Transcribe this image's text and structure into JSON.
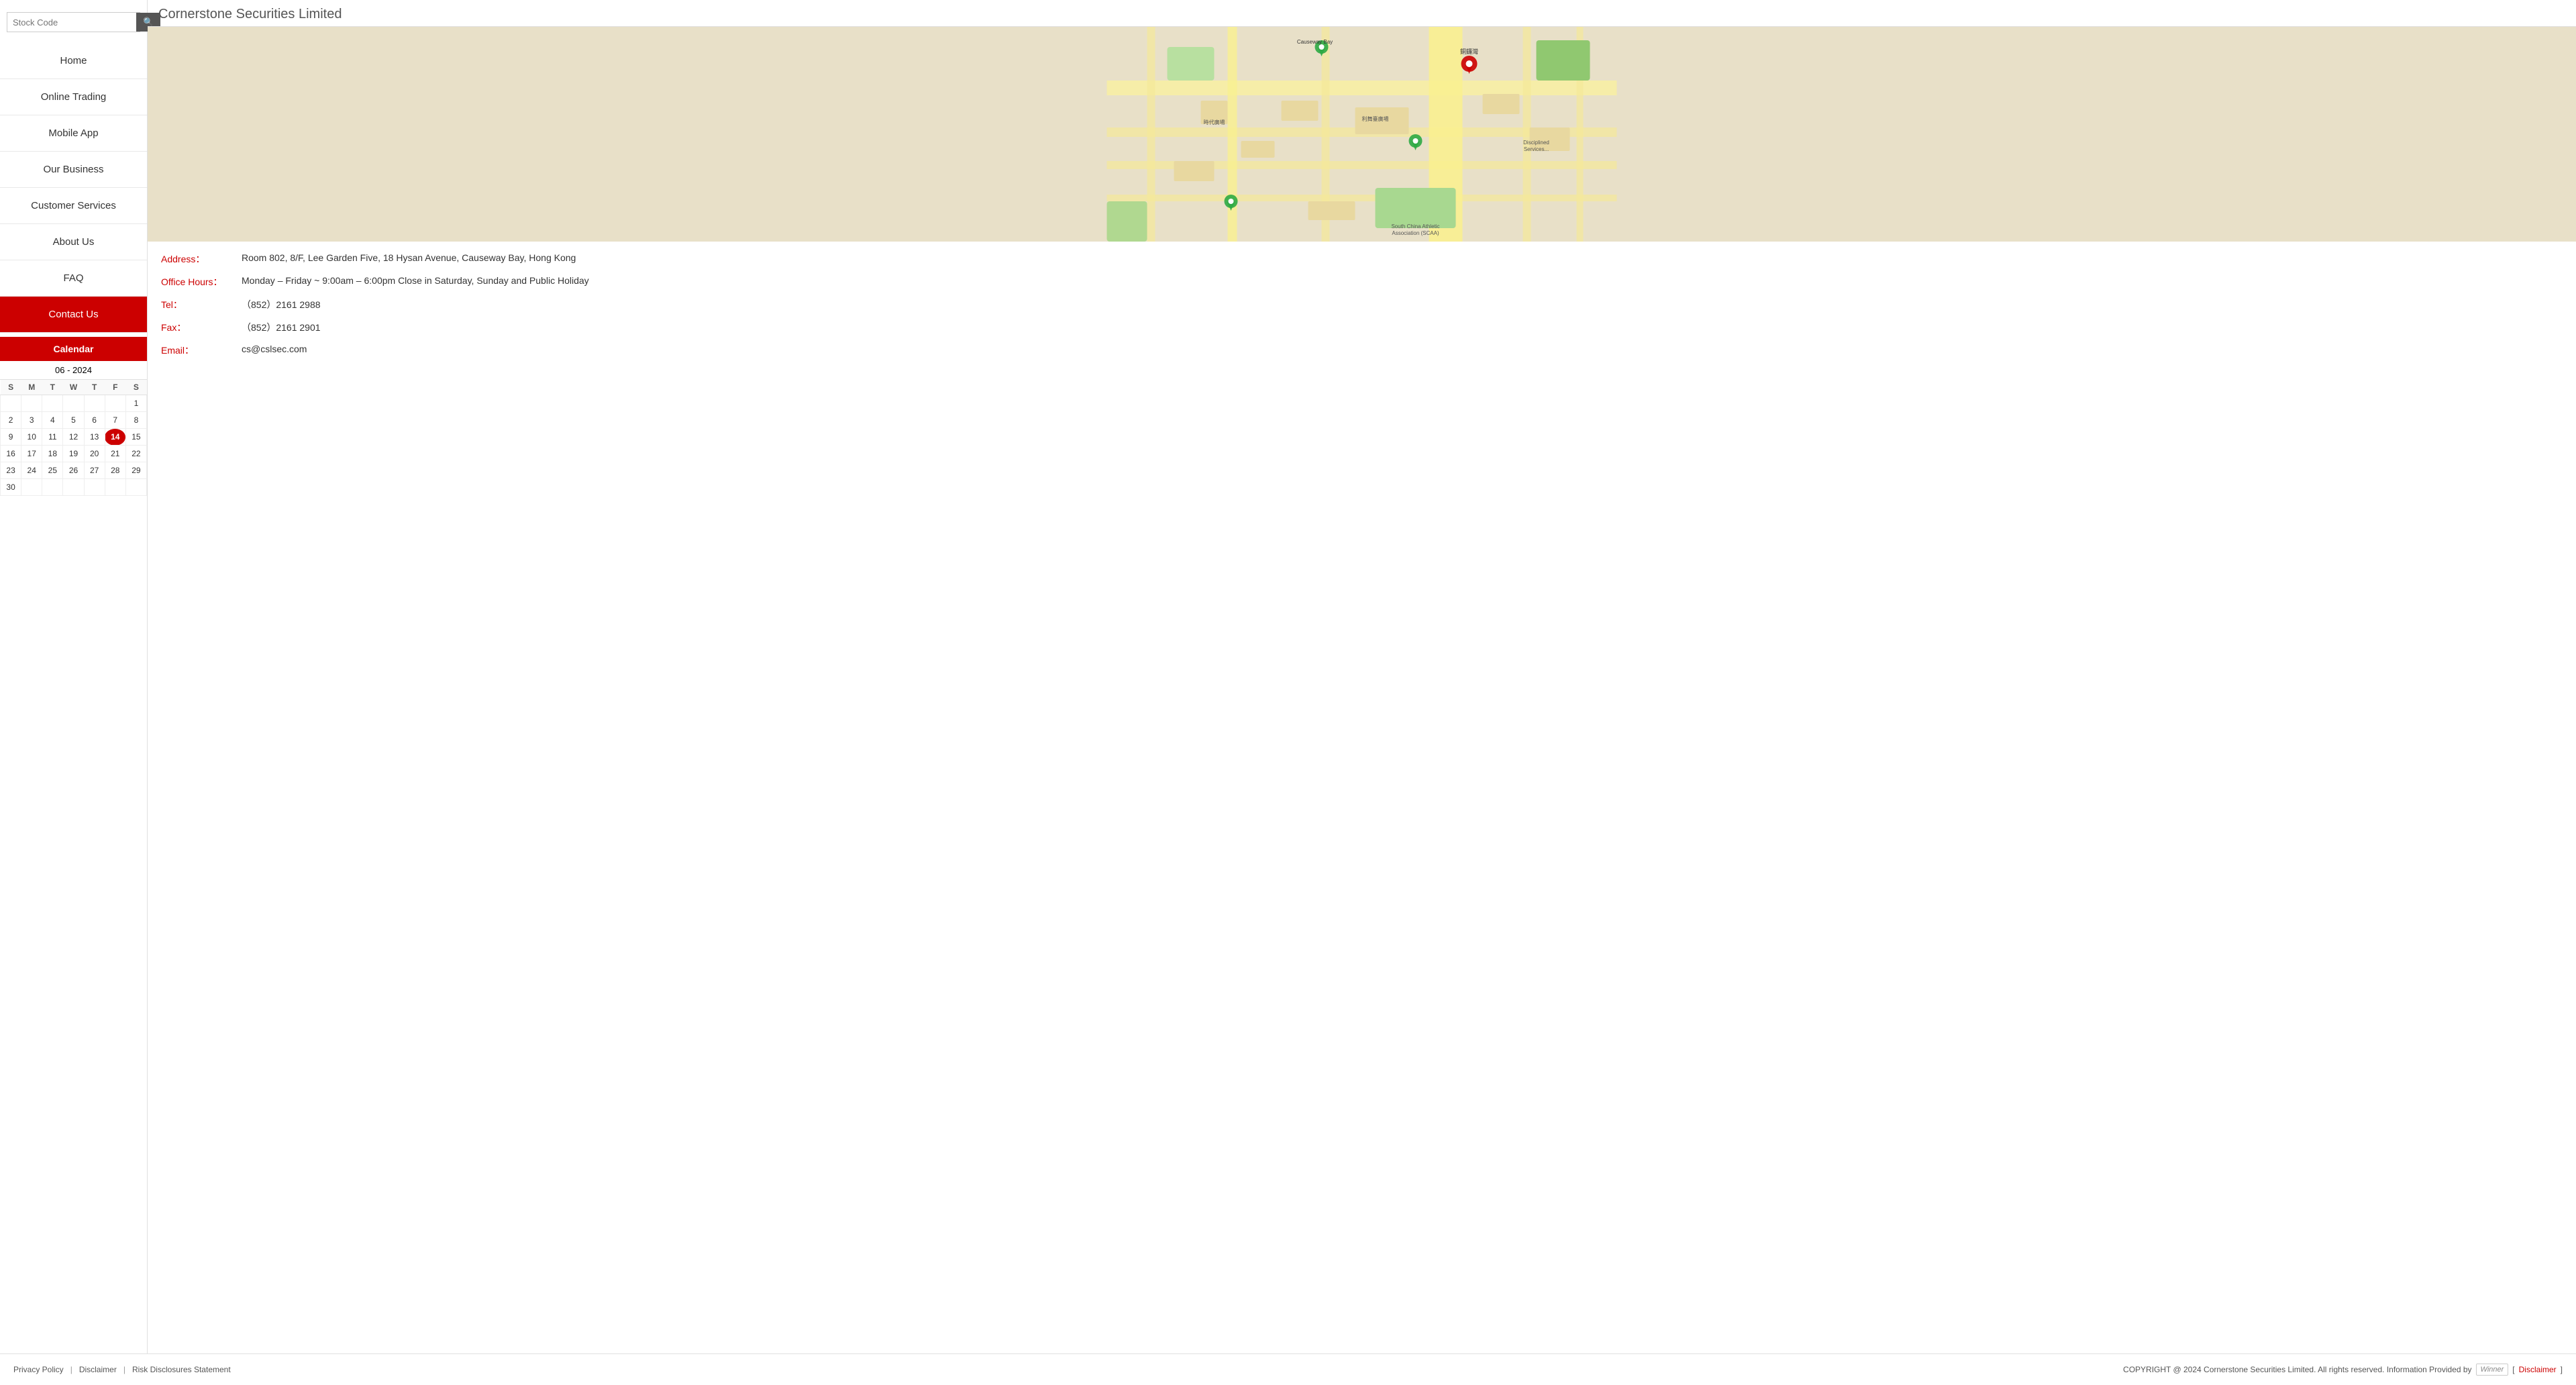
{
  "header": {
    "company_name": "Cornerstone Securities Limited"
  },
  "search": {
    "placeholder": "Stock Code",
    "button_label": "🔍"
  },
  "nav": {
    "items": [
      {
        "label": "Home",
        "id": "home",
        "active": false
      },
      {
        "label": "Online Trading",
        "id": "online-trading",
        "active": false
      },
      {
        "label": "Mobile App",
        "id": "mobile-app",
        "active": false
      },
      {
        "label": "Our Business",
        "id": "our-business",
        "active": false
      },
      {
        "label": "Customer Services",
        "id": "customer-services",
        "active": false
      },
      {
        "label": "About Us",
        "id": "about-us",
        "active": false
      },
      {
        "label": "FAQ",
        "id": "faq",
        "active": false
      },
      {
        "label": "Contact Us",
        "id": "contact-us",
        "active": true
      }
    ]
  },
  "calendar": {
    "header": "Calendar",
    "month_year": "06 - 2024",
    "days_of_week": [
      "S",
      "M",
      "T",
      "W",
      "T",
      "F",
      "S"
    ],
    "today": 14,
    "weeks": [
      [
        null,
        null,
        null,
        null,
        null,
        null,
        1
      ],
      [
        2,
        3,
        4,
        5,
        6,
        7,
        8
      ],
      [
        9,
        10,
        11,
        12,
        13,
        14,
        15
      ],
      [
        16,
        17,
        18,
        19,
        20,
        21,
        22
      ],
      [
        23,
        24,
        25,
        26,
        27,
        28,
        29
      ],
      [
        30,
        null,
        null,
        null,
        null,
        null,
        null
      ]
    ]
  },
  "contact": {
    "title": "Cornerstone Securities Limited",
    "address_label": "Address：",
    "address_value": "Room 802, 8/F, Lee Garden Five, 18 Hysan Avenue, Causeway Bay, Hong Kong",
    "office_hours_label": "Office Hours：",
    "office_hours_value": "Monday – Friday ~ 9:00am – 6:00pm    Close in Saturday, Sunday and Public Holiday",
    "tel_label": "Tel：",
    "tel_value": "（852）2161 2988",
    "fax_label": "Fax：",
    "fax_value": "（852）2161 2901",
    "email_label": "Email：",
    "email_value": "cs@cslsec.com"
  },
  "footer": {
    "privacy_policy": "Privacy Policy",
    "disclaimer": "Disclaimer",
    "risk_disclosures": "Risk Disclosures Statement",
    "copyright": "COPYRIGHT @ 2024 Cornerstone Securities Limited. All rights reserved.   Information Provided by",
    "provider": "Winner",
    "disclaimer_bracket_open": "[ ",
    "disclaimer_link": "Disclaimer",
    "disclaimer_bracket_close": " ]"
  }
}
